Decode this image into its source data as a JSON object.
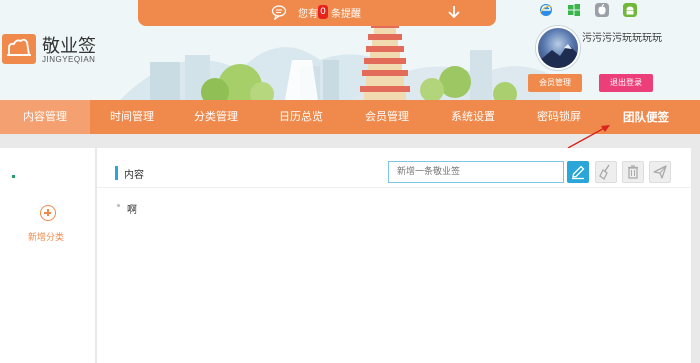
{
  "notice": {
    "prefix": "您有",
    "count": "0",
    "suffix": "条提醒"
  },
  "logo": {
    "title": "敬业签",
    "subtitle": "JINGYEQIAN"
  },
  "os_icons": [
    "ie-icon",
    "windows-icon",
    "apple-icon",
    "android-icon"
  ],
  "user": {
    "name": "污污污污玩玩玩玩",
    "member_button": "会员管理",
    "logout_button": "退出登录"
  },
  "nav": {
    "items": [
      {
        "label": "内容管理"
      },
      {
        "label": "时间管理"
      },
      {
        "label": "分类管理"
      },
      {
        "label": "日历总览"
      },
      {
        "label": "会员管理"
      },
      {
        "label": "系统设置"
      },
      {
        "label": "密码锁屏"
      },
      {
        "label": "团队便签"
      }
    ],
    "active_index": 0
  },
  "sidebar": {
    "add_category_label": "新增分类"
  },
  "main": {
    "title": "内容",
    "input_placeholder": "新增一条敬业签",
    "notes": [
      "啊"
    ]
  },
  "colors": {
    "brand_orange": "#ef8a4c",
    "nav_active": "#f4a070",
    "accent_blue": "#2aa6d8",
    "logout_pink": "#ec3f7a",
    "notice_red": "#e8231e"
  }
}
